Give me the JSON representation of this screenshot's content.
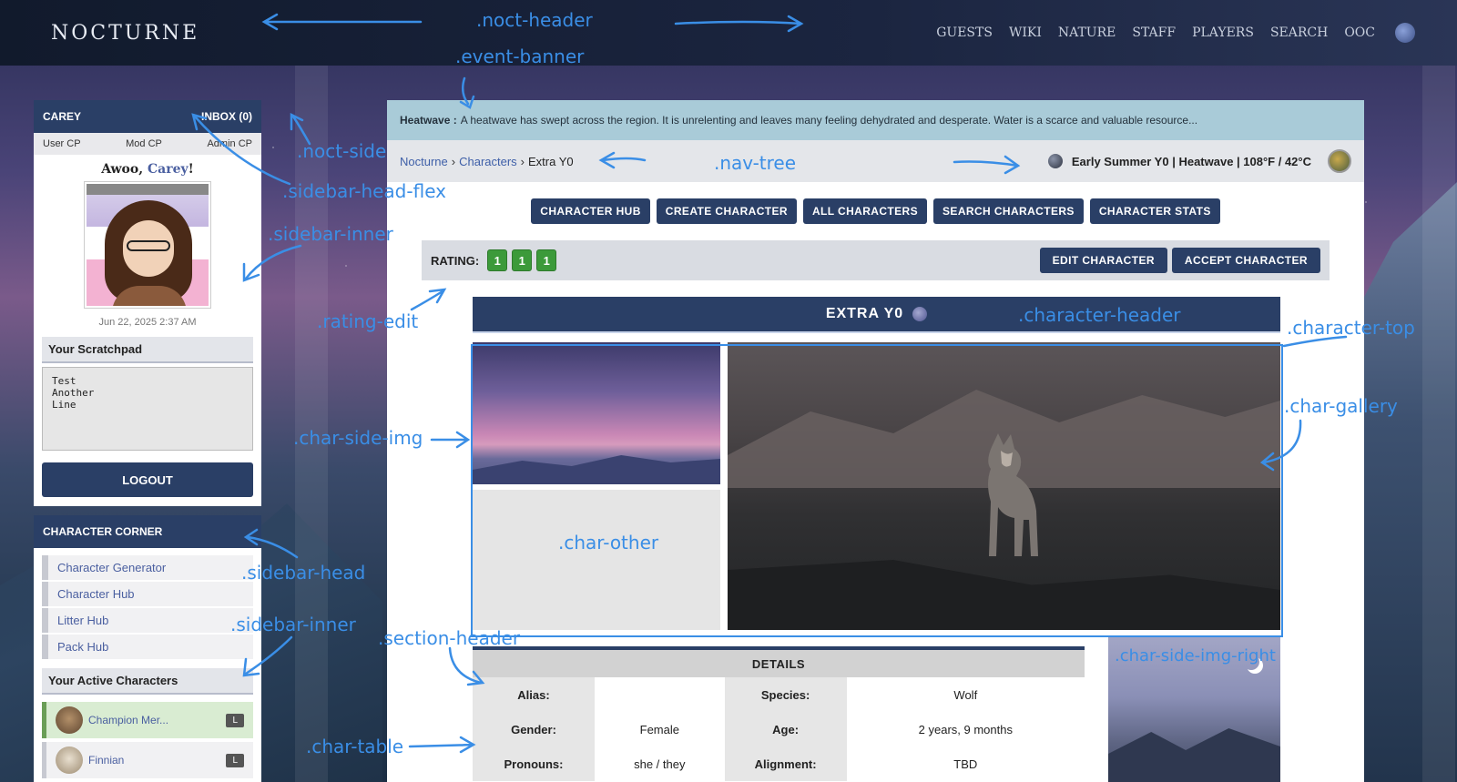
{
  "header": {
    "site_title": "NOCTURNE",
    "nav": [
      "GUESTS",
      "WIKI",
      "NATURE",
      "STAFF",
      "PLAYERS",
      "SEARCH",
      "OOC"
    ]
  },
  "sidebar": {
    "user_name": "CAREY",
    "inbox": "INBOX (0)",
    "cp_links": [
      "User CP",
      "Mod CP",
      "Admin CP"
    ],
    "greeting_prefix": "Awoo, ",
    "greeting_name": "Carey",
    "greeting_suffix": "!",
    "timestamp": "Jun 22, 2025 2:37 AM",
    "scratchpad_title": "Your Scratchpad",
    "scratchpad_text": "Test\nAnother\nLine",
    "logout": "LOGOUT",
    "character_corner_title": "CHARACTER CORNER",
    "character_links": [
      "Character Generator",
      "Character Hub",
      "Litter Hub",
      "Pack Hub"
    ],
    "active_characters_title": "Your Active Characters",
    "active_characters": [
      {
        "name": "Champion Mer...",
        "badge": "L"
      },
      {
        "name": "Finnian",
        "badge": "L"
      }
    ]
  },
  "event": {
    "label": "Heatwave :",
    "text": "A heatwave has swept across the region. It is unrelenting and leaves many feeling dehydrated and desperate. Water is a scarce and valuable resource..."
  },
  "nav_tree": {
    "crumbs": [
      "Nocturne",
      "Characters"
    ],
    "current": "Extra Y0",
    "season": "Early Summer Y0 | Heatwave | 108°F / 42°C"
  },
  "hub_buttons": [
    "CHARACTER HUB",
    "CREATE CHARACTER",
    "ALL CHARACTERS",
    "SEARCH CHARACTERS",
    "CHARACTER STATS"
  ],
  "rating": {
    "label": "RATING:",
    "values": [
      "1",
      "1",
      "1"
    ],
    "actions": [
      "EDIT CHARACTER",
      "ACCEPT CHARACTER"
    ]
  },
  "character": {
    "name": "EXTRA Y0",
    "details_title": "DETAILS",
    "rows": [
      [
        {
          "k": "Alias:",
          "v": ""
        },
        {
          "k": "Species:",
          "v": "Wolf"
        }
      ],
      [
        {
          "k": "Gender:",
          "v": "Female"
        },
        {
          "k": "Age:",
          "v": "2 years, 9 months"
        }
      ],
      [
        {
          "k": "Pronouns:",
          "v": "she / they"
        },
        {
          "k": "Alignment:",
          "v": "TBD"
        }
      ]
    ]
  },
  "annotations": {
    "noct_header": ".noct-header",
    "event_banner": ".event-banner",
    "noct_side": ".noct-side",
    "sidebar_head_flex": ".sidebar-head-flex",
    "sidebar_inner_1": ".sidebar-inner",
    "rating_edit": ".rating-edit",
    "nav_tree": ".nav-tree",
    "character_header": ".character-header",
    "character_top": ".character-top",
    "char_gallery": ".char-gallery",
    "char_side_img": ".char-side-img",
    "char_other": ".char-other",
    "sidebar_head": ".sidebar-head",
    "sidebar_inner_2": ".sidebar-inner",
    "section_header": ".section-header",
    "char_side_img_right": ".char-side-img-right",
    "char_table": ".char-table"
  },
  "colors": {
    "primary_navy": "#2a3f66",
    "event_banner": "#a9cbd8",
    "rating_green": "#3c9a3a",
    "link_blue": "#3e5fa8",
    "annotation_blue": "#3a8ee6"
  }
}
